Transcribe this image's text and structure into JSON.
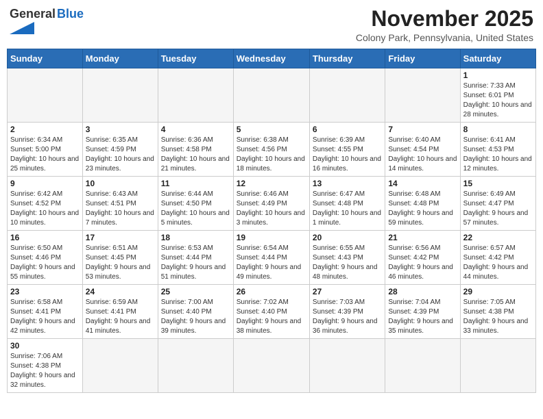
{
  "header": {
    "logo_text_general": "General",
    "logo_text_blue": "Blue",
    "month_title": "November 2025",
    "subtitle": "Colony Park, Pennsylvania, United States"
  },
  "calendar": {
    "days_of_week": [
      "Sunday",
      "Monday",
      "Tuesday",
      "Wednesday",
      "Thursday",
      "Friday",
      "Saturday"
    ],
    "weeks": [
      [
        {
          "day": "",
          "info": ""
        },
        {
          "day": "",
          "info": ""
        },
        {
          "day": "",
          "info": ""
        },
        {
          "day": "",
          "info": ""
        },
        {
          "day": "",
          "info": ""
        },
        {
          "day": "",
          "info": ""
        },
        {
          "day": "1",
          "info": "Sunrise: 7:33 AM\nSunset: 6:01 PM\nDaylight: 10 hours and 28 minutes."
        }
      ],
      [
        {
          "day": "2",
          "info": "Sunrise: 6:34 AM\nSunset: 5:00 PM\nDaylight: 10 hours and 25 minutes."
        },
        {
          "day": "3",
          "info": "Sunrise: 6:35 AM\nSunset: 4:59 PM\nDaylight: 10 hours and 23 minutes."
        },
        {
          "day": "4",
          "info": "Sunrise: 6:36 AM\nSunset: 4:58 PM\nDaylight: 10 hours and 21 minutes."
        },
        {
          "day": "5",
          "info": "Sunrise: 6:38 AM\nSunset: 4:56 PM\nDaylight: 10 hours and 18 minutes."
        },
        {
          "day": "6",
          "info": "Sunrise: 6:39 AM\nSunset: 4:55 PM\nDaylight: 10 hours and 16 minutes."
        },
        {
          "day": "7",
          "info": "Sunrise: 6:40 AM\nSunset: 4:54 PM\nDaylight: 10 hours and 14 minutes."
        },
        {
          "day": "8",
          "info": "Sunrise: 6:41 AM\nSunset: 4:53 PM\nDaylight: 10 hours and 12 minutes."
        }
      ],
      [
        {
          "day": "9",
          "info": "Sunrise: 6:42 AM\nSunset: 4:52 PM\nDaylight: 10 hours and 10 minutes."
        },
        {
          "day": "10",
          "info": "Sunrise: 6:43 AM\nSunset: 4:51 PM\nDaylight: 10 hours and 7 minutes."
        },
        {
          "day": "11",
          "info": "Sunrise: 6:44 AM\nSunset: 4:50 PM\nDaylight: 10 hours and 5 minutes."
        },
        {
          "day": "12",
          "info": "Sunrise: 6:46 AM\nSunset: 4:49 PM\nDaylight: 10 hours and 3 minutes."
        },
        {
          "day": "13",
          "info": "Sunrise: 6:47 AM\nSunset: 4:48 PM\nDaylight: 10 hours and 1 minute."
        },
        {
          "day": "14",
          "info": "Sunrise: 6:48 AM\nSunset: 4:48 PM\nDaylight: 9 hours and 59 minutes."
        },
        {
          "day": "15",
          "info": "Sunrise: 6:49 AM\nSunset: 4:47 PM\nDaylight: 9 hours and 57 minutes."
        }
      ],
      [
        {
          "day": "16",
          "info": "Sunrise: 6:50 AM\nSunset: 4:46 PM\nDaylight: 9 hours and 55 minutes."
        },
        {
          "day": "17",
          "info": "Sunrise: 6:51 AM\nSunset: 4:45 PM\nDaylight: 9 hours and 53 minutes."
        },
        {
          "day": "18",
          "info": "Sunrise: 6:53 AM\nSunset: 4:44 PM\nDaylight: 9 hours and 51 minutes."
        },
        {
          "day": "19",
          "info": "Sunrise: 6:54 AM\nSunset: 4:44 PM\nDaylight: 9 hours and 49 minutes."
        },
        {
          "day": "20",
          "info": "Sunrise: 6:55 AM\nSunset: 4:43 PM\nDaylight: 9 hours and 48 minutes."
        },
        {
          "day": "21",
          "info": "Sunrise: 6:56 AM\nSunset: 4:42 PM\nDaylight: 9 hours and 46 minutes."
        },
        {
          "day": "22",
          "info": "Sunrise: 6:57 AM\nSunset: 4:42 PM\nDaylight: 9 hours and 44 minutes."
        }
      ],
      [
        {
          "day": "23",
          "info": "Sunrise: 6:58 AM\nSunset: 4:41 PM\nDaylight: 9 hours and 42 minutes."
        },
        {
          "day": "24",
          "info": "Sunrise: 6:59 AM\nSunset: 4:41 PM\nDaylight: 9 hours and 41 minutes."
        },
        {
          "day": "25",
          "info": "Sunrise: 7:00 AM\nSunset: 4:40 PM\nDaylight: 9 hours and 39 minutes."
        },
        {
          "day": "26",
          "info": "Sunrise: 7:02 AM\nSunset: 4:40 PM\nDaylight: 9 hours and 38 minutes."
        },
        {
          "day": "27",
          "info": "Sunrise: 7:03 AM\nSunset: 4:39 PM\nDaylight: 9 hours and 36 minutes."
        },
        {
          "day": "28",
          "info": "Sunrise: 7:04 AM\nSunset: 4:39 PM\nDaylight: 9 hours and 35 minutes."
        },
        {
          "day": "29",
          "info": "Sunrise: 7:05 AM\nSunset: 4:38 PM\nDaylight: 9 hours and 33 minutes."
        }
      ],
      [
        {
          "day": "30",
          "info": "Sunrise: 7:06 AM\nSunset: 4:38 PM\nDaylight: 9 hours and 32 minutes."
        },
        {
          "day": "",
          "info": ""
        },
        {
          "day": "",
          "info": ""
        },
        {
          "day": "",
          "info": ""
        },
        {
          "day": "",
          "info": ""
        },
        {
          "day": "",
          "info": ""
        },
        {
          "day": "",
          "info": ""
        }
      ]
    ]
  }
}
